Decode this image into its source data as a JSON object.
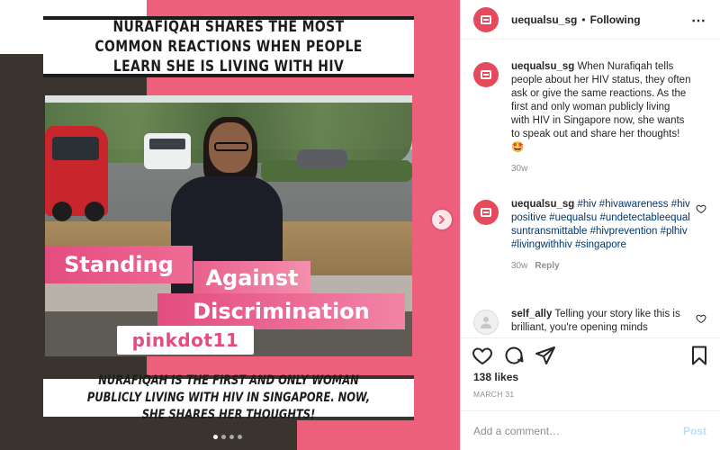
{
  "post": {
    "headline": "NURAFIQAH SHARES THE MOST COMMON REACTIONS WHEN PEOPLE LEARN SHE IS LIVING WITH HIV",
    "banner_line1": "Standing",
    "banner_line2": "Against",
    "banner_line3": "Discrimination",
    "logo_text": "pinkdot11",
    "bottom_caption": "NURAFIQAH IS THE FIRST AND ONLY WOMAN PUBLICLY LIVING WITH HIV IN SINGAPORE. NOW, SHE SHARES HER THOUGHTS!",
    "carousel_total": 4,
    "carousel_active": 1
  },
  "header": {
    "username": "uequalsu_sg",
    "separator": "•",
    "follow_status": "Following",
    "more_icon": "⋯"
  },
  "caption": {
    "username": "uequalsu_sg",
    "text": "When Nurafiqah tells people about her HIV status, they often ask or give the same reactions. As the first and only woman publicly living with HIV in Singapore now, she wants to speak out and share her thoughts! 🤩",
    "age": "30w"
  },
  "comments": [
    {
      "username": "uequalsu_sg",
      "hashtags": "#hiv #hivawareness #hivpositive #uequalsu #undetectableequalsuntransmittable #hivprevention #plhiv #livingwithhiv #singapore",
      "age": "30w",
      "reply": "Reply"
    },
    {
      "username": "self_ally",
      "text": "Telling your story like this is brilliant, you're opening minds"
    }
  ],
  "actions": {
    "likes": "138 likes",
    "date": "MARCH 31"
  },
  "add_comment": {
    "placeholder": "Add a comment…",
    "post_label": "Post"
  },
  "colors": {
    "brand_pink": "#ee5f7c",
    "dark_panel": "#3a342e",
    "avatar_red": "#e4495c",
    "hashtag_blue": "#00376b",
    "post_disabled": "#b2dffc"
  }
}
